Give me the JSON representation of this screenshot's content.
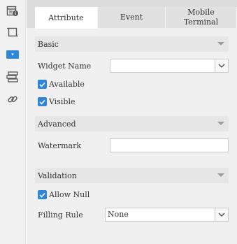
{
  "sidebar": {
    "icons": [
      "widget-settings-icon",
      "frame-icon",
      "dropdown-widget-icon",
      "list-layout-icon",
      "link-icon"
    ]
  },
  "tabs": [
    {
      "label": "Attribute",
      "active": true
    },
    {
      "label": "Event",
      "active": false
    },
    {
      "label": "Mobile\nTerminal",
      "active": false
    }
  ],
  "basic": {
    "title": "Basic",
    "widget_name_label": "Widget Name",
    "widget_name_value": "",
    "available_label": "Available",
    "available_checked": true,
    "visible_label": "Visible",
    "visible_checked": true
  },
  "advanced": {
    "title": "Advanced",
    "watermark_label": "Watermark",
    "watermark_value": ""
  },
  "validation": {
    "title": "Validation",
    "allow_null_label": "Allow Null",
    "allow_null_checked": true,
    "filling_rule_label": "Filling Rule",
    "filling_rule_value": "None"
  },
  "colors": {
    "accent": "#2f86d6",
    "panel_bg": "#f0f0f0",
    "section_bg": "#e6e6e6"
  }
}
